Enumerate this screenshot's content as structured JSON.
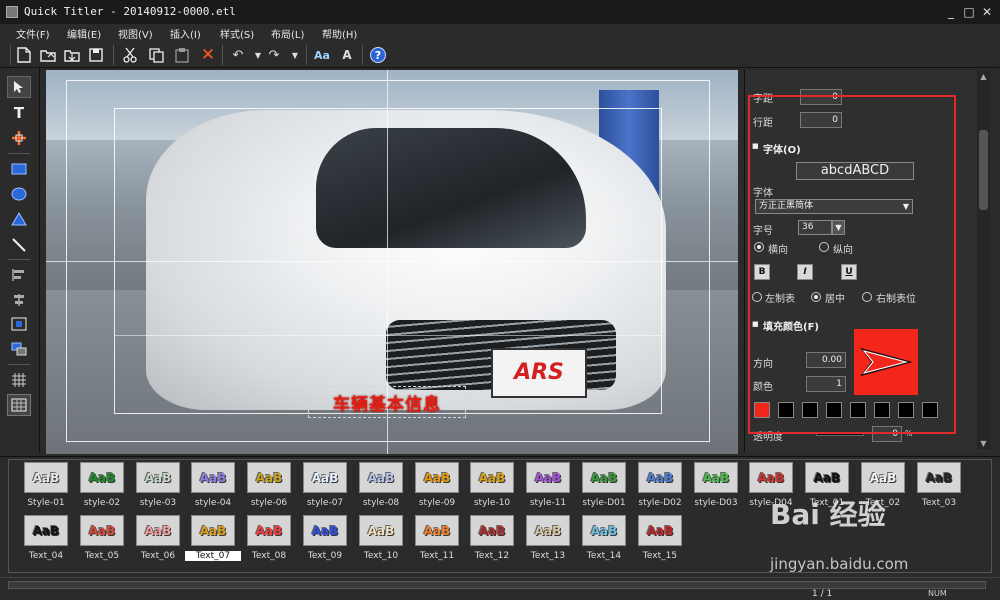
{
  "window": {
    "title": "Quick Titler - 20140912-0000.etl",
    "minimize": "_",
    "maximize": "□",
    "close": "✕"
  },
  "menu": [
    "文件(F)",
    "编辑(E)",
    "视图(V)",
    "插入(I)",
    "样式(S)",
    "布局(L)",
    "帮助(H)"
  ],
  "toolbar": {
    "icons": [
      "new-file-icon",
      "open-file-icon",
      "save-file-icon",
      "cut-icon",
      "copy-icon",
      "paste-icon",
      "delete-icon",
      "undo-icon",
      "redo-icon",
      "text-style-icon",
      "font-icon",
      "help-icon"
    ]
  },
  "left_tools": [
    "select-arrow-icon",
    "text-tool-icon",
    "crosshair-tool-icon",
    "rectangle-tool-icon",
    "ellipse-tool-icon",
    "triangle-tool-icon",
    "line-tool-icon",
    "align-left-icon",
    "align-center-icon",
    "center-icon",
    "layer-icon",
    "grid-icon",
    "safe-area-icon"
  ],
  "canvas": {
    "caption": "车辆基本信息",
    "plate_text": "ARS"
  },
  "properties": {
    "char_spacing_label": "字距",
    "char_spacing_value": "0",
    "line_spacing_label": "行距",
    "line_spacing_value": "0",
    "font_section": "字体(O)",
    "font_preview": "abcdABCD",
    "font_label": "字体",
    "font_value": "方正正黑简体",
    "size_label": "字号",
    "size_value": "36",
    "horizontal": "横向",
    "vertical": "纵向",
    "bold": "B",
    "italic": "I",
    "underline": "U",
    "align_left": "左制表",
    "align_center": "居中",
    "align_right": "右制表位",
    "fill_section": "填充颜色(F)",
    "direction_label": "方向",
    "direction_value": "0.00",
    "color_label": "颜色",
    "color_value": "1",
    "opacity_label": "透明度",
    "opacity_value": "0",
    "opacity_unit": "%",
    "fill_color": "#f2261a",
    "swatches": [
      "#f2261a",
      "#000000",
      "#000000",
      "#000000",
      "#000000",
      "#000000",
      "#000000",
      "#000000"
    ]
  },
  "styles": {
    "sample": "AaB",
    "row1": [
      {
        "label": "Style-01",
        "color": "#e8e8e8"
      },
      {
        "label": "style-02",
        "color": "#1f8a2a"
      },
      {
        "label": "style-03",
        "color": "#c6d8c8"
      },
      {
        "label": "style-04",
        "color": "#8a7fe0"
      },
      {
        "label": "style-06",
        "color": "#c7a526"
      },
      {
        "label": "style-07",
        "color": "#e6f0ff"
      },
      {
        "label": "style-08",
        "color": "#b9c4e8"
      },
      {
        "label": "style-09",
        "color": "#e59a10"
      },
      {
        "label": "style-10",
        "color": "#d9a21c"
      },
      {
        "label": "style-11",
        "color": "#a450d8"
      },
      {
        "label": "style-D01",
        "color": "#3b9a3a"
      },
      {
        "label": "style-D02",
        "color": "#4e7cd1"
      },
      {
        "label": "style-D03",
        "color": "#4fbd52"
      },
      {
        "label": "style-D04",
        "color": "#d03030"
      },
      {
        "label": "Text_01",
        "color": "#111111"
      },
      {
        "label": "Text_02",
        "color": "#f2f2f2"
      },
      {
        "label": "Text_03",
        "color": "#222222"
      }
    ],
    "row2": [
      {
        "label": "Text_04",
        "color": "#111111"
      },
      {
        "label": "Text_05",
        "color": "#d64a3a"
      },
      {
        "label": "Text_06",
        "color": "#f0a0a0"
      },
      {
        "label": "Text_07",
        "color": "#d8a01c",
        "selected": true
      },
      {
        "label": "Text_08",
        "color": "#f04040"
      },
      {
        "label": "Text_09",
        "color": "#3050e0"
      },
      {
        "label": "Text_10",
        "color": "#f0e0c0"
      },
      {
        "label": "Text_11",
        "color": "#f08030"
      },
      {
        "label": "Text_12",
        "color": "#b03030"
      },
      {
        "label": "Text_13",
        "color": "#d8c8a8"
      },
      {
        "label": "Text_14",
        "color": "#70c0e0"
      },
      {
        "label": "Text_15",
        "color": "#c02828"
      }
    ]
  },
  "status": {
    "page": "1 / 1",
    "num": "NUM"
  },
  "watermark": {
    "brand": "Bai 经验",
    "url": "jingyan.baidu.com"
  }
}
